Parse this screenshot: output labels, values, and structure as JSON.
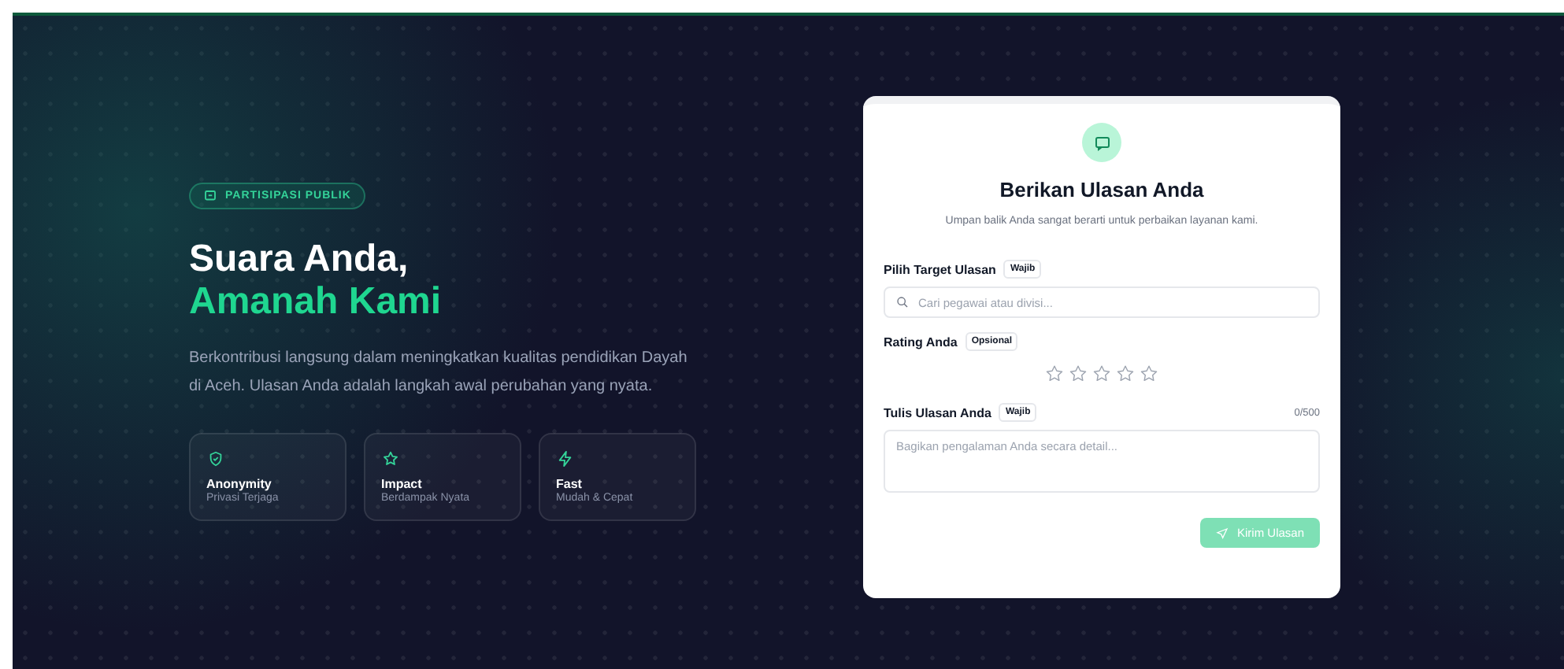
{
  "hero": {
    "badge": "PARTISIPASI PUBLIK",
    "title_line_1": "Suara Anda,",
    "title_line_2": "Amanah Kami",
    "description": "Berkontribusi langsung dalam meningkatkan kualitas pendidikan Dayah di Aceh. Ulasan Anda adalah langkah awal perubahan yang nyata.",
    "features": [
      {
        "kind": "shield",
        "title": "Anonymity",
        "subtitle": "Privasi Terjaga"
      },
      {
        "kind": "star",
        "title": "Impact",
        "subtitle": "Berdampak Nyata"
      },
      {
        "kind": "bolt",
        "title": "Fast",
        "subtitle": "Mudah & Cepat"
      }
    ]
  },
  "form": {
    "title": "Berikan Ulasan Anda",
    "subtitle": "Umpan balik Anda sangat berarti untuk perbaikan layanan kami.",
    "target": {
      "label": "Pilih Target Ulasan",
      "tag": "Wajib",
      "placeholder": "Cari pegawai atau divisi..."
    },
    "rating": {
      "label": "Rating Anda",
      "tag": "Opsional",
      "stars": 0
    },
    "review": {
      "label": "Tulis Ulasan Anda",
      "tag": "Wajib",
      "counter": "0/500",
      "placeholder": "Bagikan pengalaman Anda secara detail..."
    },
    "submit": {
      "label": "Kirim Ulasan",
      "disabled": true
    }
  }
}
